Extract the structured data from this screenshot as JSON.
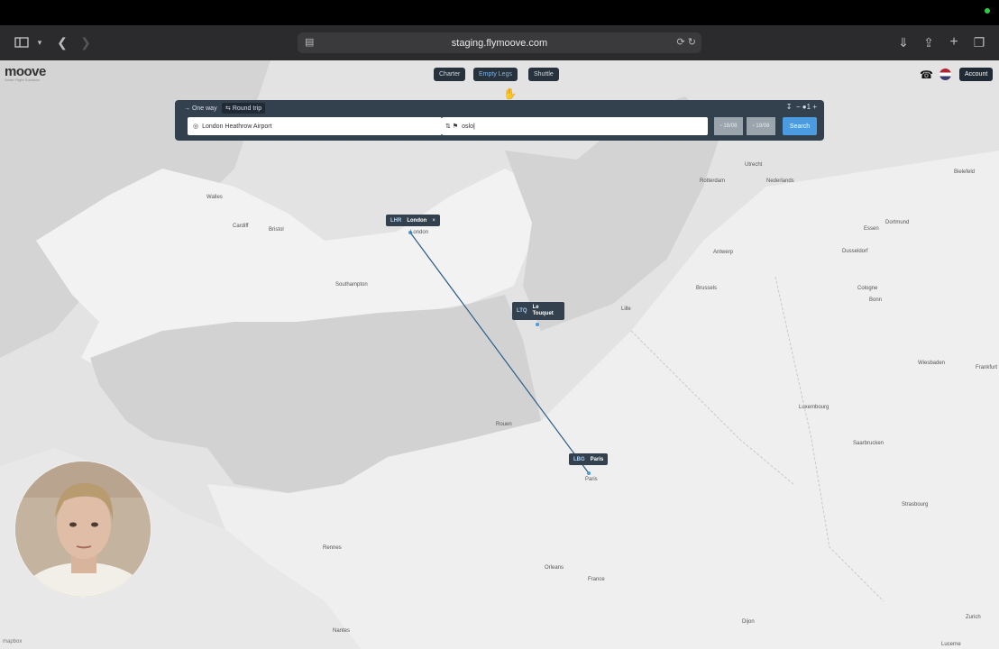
{
  "browser": {
    "url": "staging.flymoove.com",
    "icons": [
      "sidebar-icon",
      "chevron-down-icon",
      "back-icon",
      "forward-icon",
      "tab-icon",
      "translate-icon",
      "reload-icon",
      "download-icon",
      "share-icon",
      "new-tab-icon",
      "tabs-overview-icon"
    ]
  },
  "app": {
    "logo": "moove",
    "tagline": "Smart Flight Solutions",
    "nav": [
      "Charter",
      "Empty Legs",
      "Shuttle"
    ],
    "account_label": "Account"
  },
  "search": {
    "trip_types": [
      "One way",
      "Round trip"
    ],
    "selected_trip": "Round trip",
    "from_value": "London Heathrow Airport",
    "to_value": "oslo",
    "date_out": "18/08",
    "date_return": "19/08",
    "search_label": "Search",
    "passengers": "1"
  },
  "map": {
    "markers": [
      {
        "code": "LHR",
        "city": "London"
      },
      {
        "code": "LTQ",
        "city": "Le Touquet"
      },
      {
        "code": "LBG",
        "city": "Paris"
      }
    ],
    "places": [
      "Utrecht",
      "Rotterdam",
      "Nederlands",
      "Bielefeld",
      "Dortmund",
      "Essen",
      "Dusseldorf",
      "Antwerp",
      "Brussels",
      "Cologne",
      "Bonn",
      "Lille",
      "Wiesbaden",
      "Luxembourg",
      "Saarbrucken",
      "Frankfurt",
      "Strasbourg",
      "Rouen",
      "Rennes",
      "Orleans",
      "France",
      "Dijon",
      "Nantes",
      "Zurich",
      "Lucerne",
      "Cardiff",
      "Bristol",
      "London",
      "Paris",
      "Southampton",
      "Walles"
    ],
    "attribution": "mapbox"
  }
}
